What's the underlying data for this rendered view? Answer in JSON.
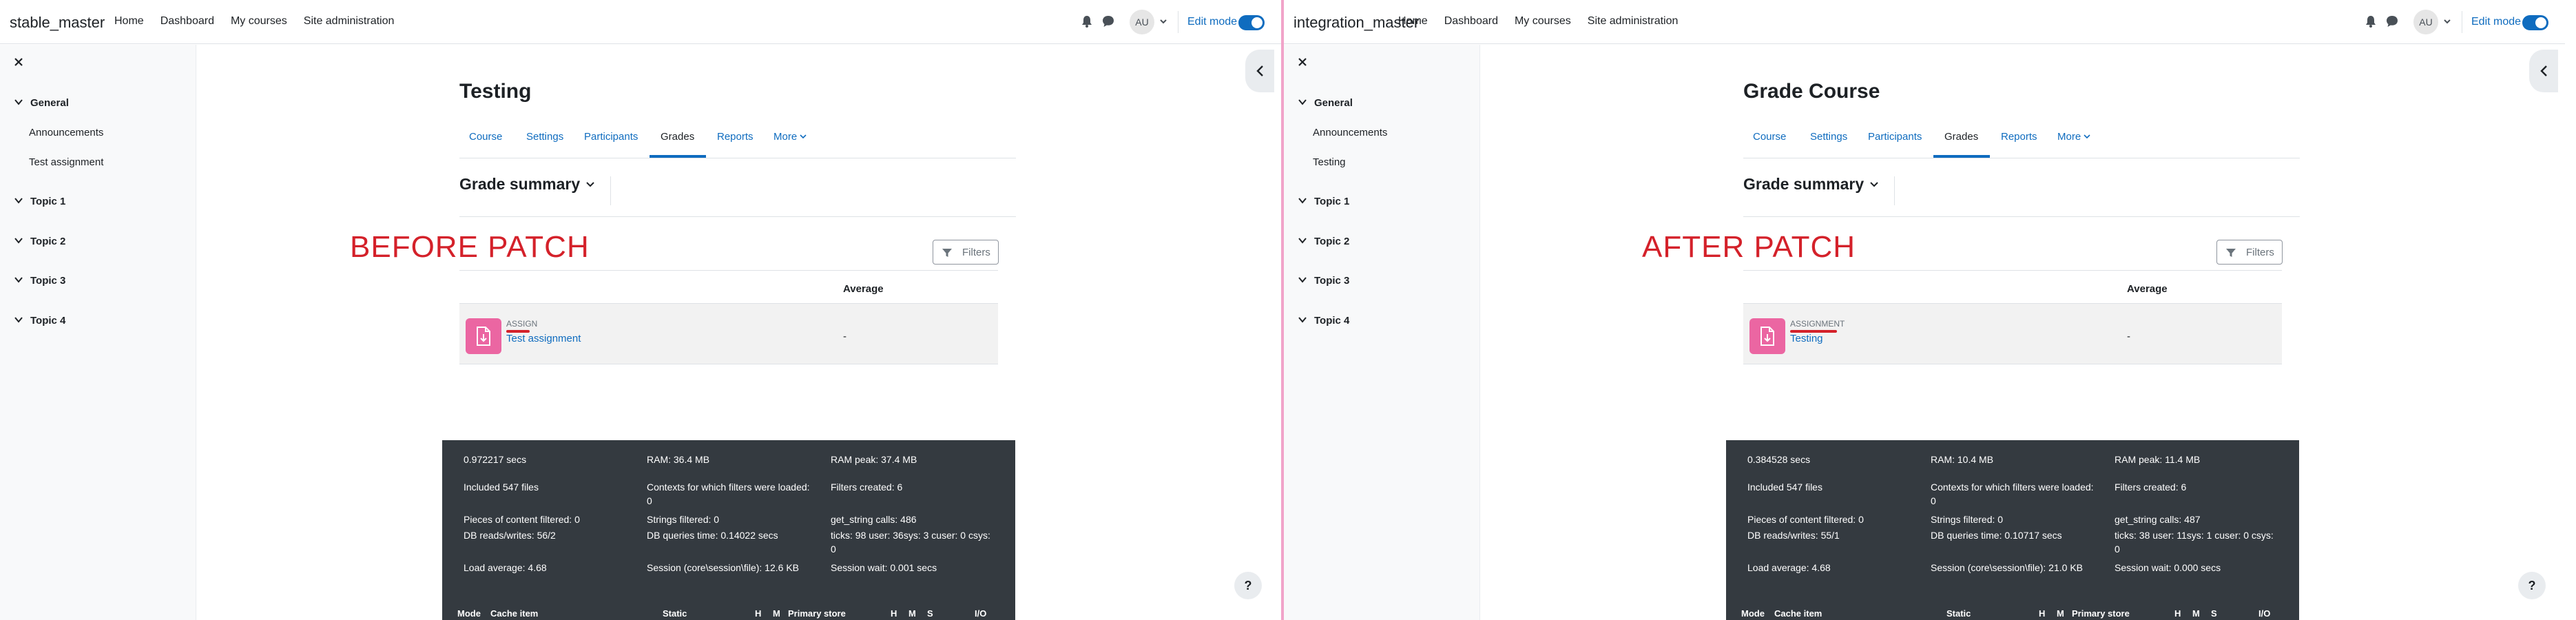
{
  "before": {
    "site_name": "stable_master",
    "nav": [
      "Home",
      "Dashboard",
      "My courses",
      "Site administration"
    ],
    "avatar_initials": "AU",
    "edit_mode_label": "Edit mode",
    "course_index": {
      "sections": [
        "General",
        "Topic 1",
        "Topic 2",
        "Topic 3",
        "Topic 4"
      ],
      "general_items": [
        "Announcements",
        "Test assignment"
      ]
    },
    "page_title": "Testing",
    "tabs": [
      "Course",
      "Settings",
      "Participants",
      "Grades",
      "Reports",
      "More"
    ],
    "active_tab": "Grades",
    "tertiary_title": "Grade summary",
    "patch_label": "BEFORE PATCH",
    "filters_label": "Filters",
    "table": {
      "average_header": "Average",
      "row": {
        "type": "ASSIGN",
        "name": "Test assignment",
        "average": "-"
      }
    },
    "perf": {
      "time": "0.972217 secs",
      "ram": "RAM: 36.4 MB",
      "ram_peak": "RAM peak: 37.4 MB",
      "included_files": "Included 547 files",
      "contexts_filters": "Contexts for which filters were loaded: 0",
      "filters_created": "Filters created: 6",
      "pieces_filtered": "Pieces of content filtered: 0",
      "strings_filtered": "Strings filtered: 0",
      "get_string": "get_string calls: 486",
      "db_rw": "DB reads/writes: 56/2",
      "db_time": "DB queries time: 0.14022 secs",
      "ticks": "ticks: 98 user: 36sys: 3 cuser: 0 csys: 0",
      "load_avg": "Load average: 4.68",
      "session": "Session (core\\session\\file): 12.6 KB",
      "session_wait": "Session wait: 0.001 secs",
      "table_headers": [
        "Mode",
        "Cache item",
        "Static",
        "H",
        "M",
        "Primary store",
        "H",
        "M",
        "S",
        "I/O"
      ]
    }
  },
  "after": {
    "site_name": "integration_master",
    "nav": [
      "Home",
      "Dashboard",
      "My courses",
      "Site administration"
    ],
    "avatar_initials": "AU",
    "edit_mode_label": "Edit mode",
    "course_index": {
      "sections": [
        "General",
        "Topic 1",
        "Topic 2",
        "Topic 3",
        "Topic 4"
      ],
      "general_items": [
        "Announcements",
        "Testing"
      ]
    },
    "page_title": "Grade Course",
    "tabs": [
      "Course",
      "Settings",
      "Participants",
      "Grades",
      "Reports",
      "More"
    ],
    "active_tab": "Grades",
    "tertiary_title": "Grade summary",
    "patch_label": "AFTER PATCH",
    "filters_label": "Filters",
    "table": {
      "average_header": "Average",
      "row": {
        "type": "ASSIGNMENT",
        "name": "Testing",
        "average": "-"
      }
    },
    "perf": {
      "time": "0.384528 secs",
      "ram": "RAM: 10.4 MB",
      "ram_peak": "RAM peak: 11.4 MB",
      "included_files": "Included 547 files",
      "contexts_filters": "Contexts for which filters were loaded: 0",
      "filters_created": "Filters created: 6",
      "pieces_filtered": "Pieces of content filtered: 0",
      "strings_filtered": "Strings filtered: 0",
      "get_string": "get_string calls: 487",
      "db_rw": "DB reads/writes: 55/1",
      "db_time": "DB queries time: 0.10717 secs",
      "ticks": "ticks: 38 user: 11sys: 1 cuser: 0 csys: 0",
      "load_avg": "Load average: 4.68",
      "session": "Session (core\\session\\file): 21.0 KB",
      "session_wait": "Session wait: 0.000 secs",
      "table_headers": [
        "Mode",
        "Cache item",
        "Static",
        "H",
        "M",
        "Primary store",
        "H",
        "M",
        "S",
        "I/O"
      ]
    }
  },
  "colors": {
    "link": "#0f6cbf",
    "annotation_red": "#d4212a",
    "assign_icon_bg": "#eb66a2",
    "perf_bg": "#343a40",
    "divider_pink": "#f1a4c9"
  }
}
